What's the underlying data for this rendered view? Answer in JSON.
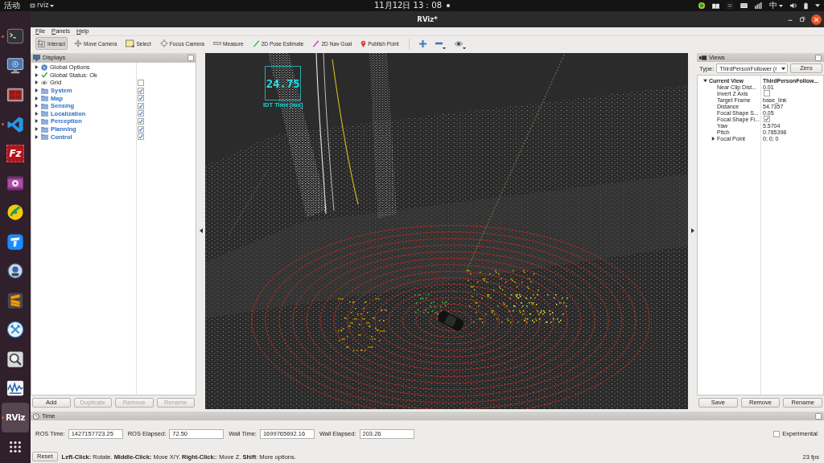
{
  "top_bar": {
    "activities": "活动",
    "app_name": "rviz",
    "clock": "11月12日 13：08",
    "input_method": "中"
  },
  "dock": {
    "items": [
      {
        "kind": "terminal",
        "running": true,
        "selected": false
      },
      {
        "kind": "monitor",
        "running": false,
        "selected": false
      },
      {
        "kind": "panel",
        "running": false,
        "selected": false
      },
      {
        "kind": "code",
        "running": true,
        "selected": false
      },
      {
        "kind": "filezilla",
        "logo": "Fz",
        "running": false,
        "selected": false
      },
      {
        "kind": "video",
        "running": false,
        "selected": false
      },
      {
        "kind": "disc",
        "running": false,
        "selected": false
      },
      {
        "kind": "tile",
        "running": false,
        "selected": false
      },
      {
        "kind": "mascot",
        "running": false,
        "selected": false
      },
      {
        "kind": "stripes",
        "running": false,
        "selected": false
      },
      {
        "kind": "remote",
        "running": false,
        "selected": false
      },
      {
        "kind": "search",
        "running": false,
        "selected": false
      },
      {
        "kind": "wave",
        "running": false,
        "selected": false
      },
      {
        "kind": "rviz",
        "logo": "RViz",
        "running": true,
        "selected": true
      },
      {
        "kind": "apps",
        "running": false,
        "selected": false
      }
    ]
  },
  "window": {
    "title": "RViz*"
  },
  "menu": [
    "File",
    "Panels",
    "Help"
  ],
  "toolbar": {
    "tools": [
      {
        "label": "Interact",
        "kind": "interact",
        "selected": true
      },
      {
        "label": "Move Camera",
        "kind": "move",
        "selected": false
      },
      {
        "label": "Select",
        "kind": "select",
        "selected": false
      },
      {
        "label": "Focus Camera",
        "kind": "focus",
        "selected": false
      },
      {
        "label": "Measure",
        "kind": "measure",
        "selected": false
      },
      {
        "label": "2D Pose Estimate",
        "kind": "pose",
        "selected": false
      },
      {
        "label": "2D Nav Goal",
        "kind": "goal",
        "selected": false
      },
      {
        "label": "Publish Point",
        "kind": "point",
        "selected": false
      }
    ],
    "view_buttons": [
      {
        "kind": "plus",
        "menu": false
      },
      {
        "kind": "minus",
        "menu": true
      },
      {
        "kind": "eye",
        "menu": true
      }
    ]
  },
  "displays": {
    "title": "Displays",
    "items": [
      {
        "label": "Global Options",
        "kind": "options",
        "expanded": false
      },
      {
        "label": "Global Status: Ok",
        "kind": "status",
        "expanded": false
      },
      {
        "label": "Grid",
        "kind": "display",
        "expanded": false,
        "checked": false
      },
      {
        "label": "System",
        "kind": "group",
        "expanded": false,
        "checked": true
      },
      {
        "label": "Map",
        "kind": "group",
        "expanded": false,
        "checked": true
      },
      {
        "label": "Sensing",
        "kind": "group",
        "expanded": false,
        "checked": true
      },
      {
        "label": "Localization",
        "kind": "group",
        "expanded": false,
        "checked": true
      },
      {
        "label": "Perception",
        "kind": "group",
        "expanded": false,
        "checked": true
      },
      {
        "label": "Planning",
        "kind": "group",
        "expanded": false,
        "checked": true
      },
      {
        "label": "Control",
        "kind": "group",
        "expanded": false,
        "checked": true
      }
    ],
    "buttons": [
      {
        "label": "Add",
        "disabled": false
      },
      {
        "label": "Duplicate",
        "disabled": true
      },
      {
        "label": "Remove",
        "disabled": true
      },
      {
        "label": "Rename",
        "disabled": true
      }
    ]
  },
  "viewport": {
    "overlay": {
      "value": "24.75",
      "label": "IDT Time [ms]"
    }
  },
  "views": {
    "title": "Views",
    "type_label": "Type:",
    "type_value": "ThirdPersonFollower (r",
    "zero_button": "Zero",
    "tree": [
      {
        "name": "Current View",
        "kind": "value",
        "value": "ThirdPersonFollow...",
        "expanded": true,
        "children": [
          {
            "name": "Near Clip Dist...",
            "kind": "value",
            "value": "0.01"
          },
          {
            "name": "Invert Z Axis",
            "kind": "checkbox",
            "checked": false
          },
          {
            "name": "Target Frame",
            "kind": "value",
            "value": "base_link"
          },
          {
            "name": "Distance",
            "kind": "value",
            "value": "54.7357"
          },
          {
            "name": "Focal Shape S...",
            "kind": "value",
            "value": "0.05"
          },
          {
            "name": "Focal Shape Fi...",
            "kind": "checkbox",
            "checked": true
          },
          {
            "name": "Yaw",
            "kind": "value",
            "value": "5.5704"
          },
          {
            "name": "Pitch",
            "kind": "value",
            "value": "0.785398"
          },
          {
            "name": "Focal Point",
            "kind": "value",
            "value": "0; 0; 0",
            "expanded": false
          }
        ]
      }
    ],
    "buttons": [
      "Save",
      "Remove",
      "Rename"
    ]
  },
  "time_panel": {
    "title": "Time",
    "fields": [
      {
        "label": "ROS Time:",
        "value": "1427157723.25"
      },
      {
        "label": "ROS Elapsed:",
        "value": "72.50"
      },
      {
        "label": "Wall Time:",
        "value": "1699765692.16"
      },
      {
        "label": "Wall Elapsed:",
        "value": "203.26"
      }
    ],
    "experimental": {
      "label": "Experimental",
      "checked": false
    }
  },
  "status_bar": {
    "reset": "Reset",
    "help": "**Left-Click:** Rotate. **Middle-Click:** Move X/Y. **Right-Click:**: Move Z. **Shift**: More options.",
    "fps": "23 fps"
  }
}
